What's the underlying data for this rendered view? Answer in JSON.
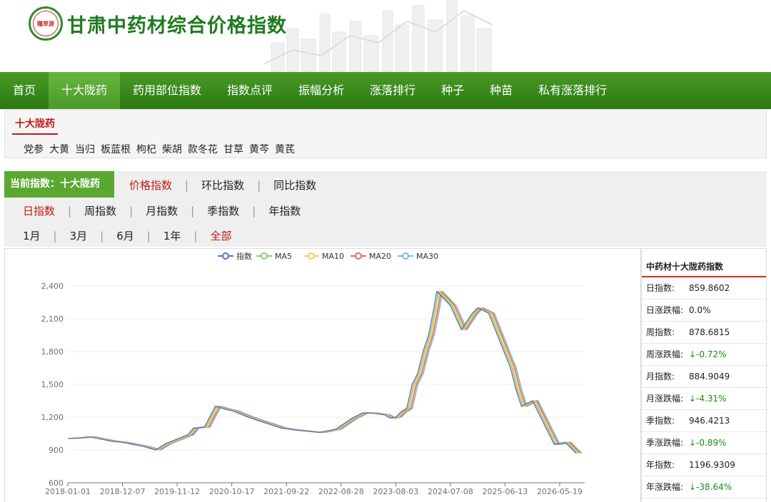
{
  "header": {
    "logo_text": "隴草源",
    "site_title": "甘肃中药材综合价格指数"
  },
  "nav": {
    "items": [
      {
        "label": "首页",
        "active": false
      },
      {
        "label": "十大陇药",
        "active": true
      },
      {
        "label": "药用部位指数",
        "active": false
      },
      {
        "label": "指数点评",
        "active": false
      },
      {
        "label": "振幅分析",
        "active": false
      },
      {
        "label": "涨落排行",
        "active": false
      },
      {
        "label": "种子",
        "active": false
      },
      {
        "label": "种苗",
        "active": false
      },
      {
        "label": "私有涨落排行",
        "active": false
      }
    ]
  },
  "category": {
    "title": "十大陇药",
    "items": [
      "党参",
      "大黄",
      "当归",
      "板蓝根",
      "枸杞",
      "柴胡",
      "款冬花",
      "甘草",
      "黄芩",
      "黄芪"
    ]
  },
  "filters": {
    "current_label": "当前指数：十大陇药",
    "index_types": [
      {
        "label": "价格指数",
        "selected": true
      },
      {
        "label": "环比指数",
        "selected": false
      },
      {
        "label": "同比指数",
        "selected": false
      }
    ],
    "periods": [
      {
        "label": "日指数",
        "selected": true
      },
      {
        "label": "周指数",
        "selected": false
      },
      {
        "label": "月指数",
        "selected": false
      },
      {
        "label": "季指数",
        "selected": false
      },
      {
        "label": "年指数",
        "selected": false
      }
    ],
    "ranges": [
      {
        "label": "1月",
        "selected": false
      },
      {
        "label": "3月",
        "selected": false
      },
      {
        "label": "6月",
        "selected": false
      },
      {
        "label": "1年",
        "selected": false
      },
      {
        "label": "全部",
        "selected": true
      }
    ]
  },
  "chart_data": {
    "type": "line",
    "legend": [
      "指数",
      "MA5",
      "MA10",
      "MA20",
      "MA30"
    ],
    "colors": [
      "#5470c6",
      "#91cc75",
      "#fac858",
      "#ee6666",
      "#73c0de"
    ],
    "ylim": [
      600,
      2400
    ],
    "yticks": [
      600,
      900,
      1200,
      1500,
      1800,
      2100,
      2400
    ],
    "yticklabels": [
      "600",
      "900",
      "1,200",
      "1,500",
      "1,800",
      "2,100",
      "2,400"
    ],
    "xticklabels": [
      "2018-01-01",
      "2018-12-07",
      "2019-11-12",
      "2020-10-17",
      "2021-09-22",
      "2022-08-28",
      "2023-08-03",
      "2024-07-08",
      "2025-06-13",
      "2026-05-19"
    ],
    "x": [
      0,
      0.2,
      0.4,
      0.6,
      0.8,
      1.0,
      1.2,
      1.4,
      1.6,
      1.8,
      2.0,
      2.2,
      2.3,
      2.5,
      2.7,
      2.9,
      3.0,
      3.3,
      3.6,
      3.9,
      4.2,
      4.6,
      4.9,
      5.2,
      5.4,
      5.6,
      5.8,
      5.9,
      6.0,
      6.1,
      6.2,
      6.3,
      6.4,
      6.5,
      6.6,
      6.7,
      6.75,
      6.85,
      7.0,
      7.2,
      7.4,
      7.5,
      7.7,
      7.9,
      8.1,
      8.2,
      8.3,
      8.5,
      8.7,
      8.9,
      9.1,
      9.3
    ],
    "values": [
      1005,
      1010,
      1020,
      1000,
      980,
      970,
      950,
      930,
      900,
      960,
      1000,
      1040,
      1100,
      1110,
      1300,
      1270,
      1260,
      1200,
      1150,
      1100,
      1080,
      1060,
      1090,
      1190,
      1240,
      1235,
      1220,
      1190,
      1200,
      1250,
      1280,
      1500,
      1600,
      1800,
      1950,
      2200,
      2350,
      2300,
      2220,
      2000,
      2150,
      2200,
      2150,
      1900,
      1650,
      1450,
      1300,
      1350,
      1150,
      950,
      970,
      870
    ]
  },
  "side_panel": {
    "title": "中药材十大陇药指数",
    "rows": [
      {
        "label": "日指数:",
        "value": "859.8602",
        "down": false
      },
      {
        "label": "日涨跌幅:",
        "value": "0.0%",
        "down": false
      },
      {
        "label": "周指数:",
        "value": "878.6815",
        "down": false
      },
      {
        "label": "周涨跌幅:",
        "value": "↓-0.72%",
        "down": true
      },
      {
        "label": "月指数:",
        "value": "884.9049",
        "down": false
      },
      {
        "label": "月涨跌幅:",
        "value": "↓-4.31%",
        "down": true
      },
      {
        "label": "季指数:",
        "value": "946.4213",
        "down": false
      },
      {
        "label": "季涨跌幅:",
        "value": "↓-0.89%",
        "down": true
      },
      {
        "label": "年指数:",
        "value": "1196.9309",
        "down": false
      },
      {
        "label": "年涨跌幅:",
        "value": "↓-38.64%",
        "down": true
      }
    ]
  }
}
